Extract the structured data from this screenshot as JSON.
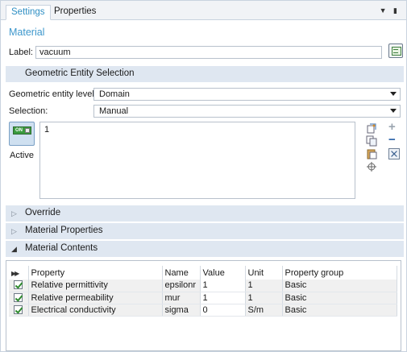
{
  "tabs": [
    {
      "label": "Settings",
      "active": true
    },
    {
      "label": "Properties",
      "active": false
    }
  ],
  "panel_title": "Material",
  "label_field": {
    "caption": "Label:",
    "value": "vacuum"
  },
  "sections": {
    "geometric_entity_selection": "Geometric Entity Selection",
    "override": "Override",
    "material_properties": "Material Properties",
    "material_contents": "Material Contents"
  },
  "geometric_entity_level": {
    "caption": "Geometric entity level:",
    "value": "Domain"
  },
  "selection": {
    "caption": "Selection:",
    "value": "Manual",
    "entries": [
      "1"
    ]
  },
  "active_toggle": {
    "badge": "ON",
    "label": "Active"
  },
  "material_table": {
    "columns": [
      "Property",
      "Name",
      "Value",
      "Unit",
      "Property group"
    ],
    "rows": [
      {
        "checked": true,
        "property": "Relative permittivity",
        "name": "epsilonr",
        "value": "1",
        "unit": "1",
        "group": "Basic"
      },
      {
        "checked": true,
        "property": "Relative permeability",
        "name": "mur",
        "value": "1",
        "unit": "1",
        "group": "Basic"
      },
      {
        "checked": true,
        "property": "Electrical conductivity",
        "name": "sigma",
        "value": "0",
        "unit": "S/m",
        "group": "Basic"
      }
    ]
  },
  "colors": {
    "accent": "#3d97cc",
    "section_bg": "#dfe7f1",
    "check_green": "#2f8a2f"
  }
}
